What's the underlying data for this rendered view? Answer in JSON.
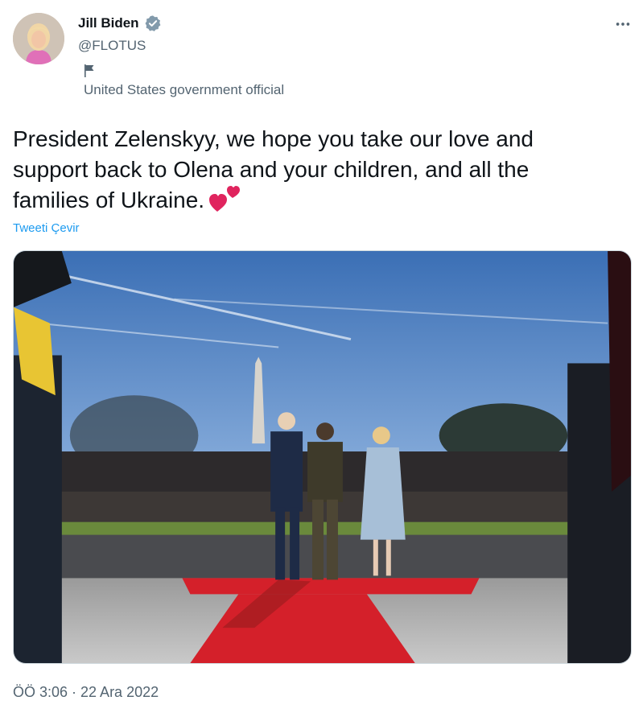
{
  "author": {
    "name": "Jill Biden",
    "handle": "@FLOTUS",
    "label": "United States government official",
    "verified_icon": "verified-badge-icon",
    "label_icon": "flag-icon"
  },
  "tweet": {
    "text": "President Zelenskyy, we hope you take our love and support back to Olena and your children, and all the families of Ukraine.",
    "emoji": "two-hearts-icon",
    "translate_label": "Tweeti Çevir",
    "timestamp": "ÖÖ 3:06 · 22 Ara 2022"
  },
  "colors": {
    "accent": "#1d9bf0",
    "text": "#0f1419",
    "secondary": "#536471",
    "heart": "#e0245e",
    "carpet": "#d4202a"
  }
}
